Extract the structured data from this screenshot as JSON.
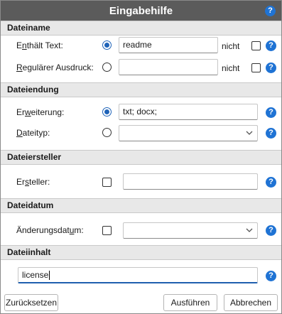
{
  "window": {
    "title": "Eingabehilfe"
  },
  "help_glyph": "?",
  "sections": {
    "dateiname": {
      "header": "Dateiname",
      "contains": {
        "label_pre": "E",
        "label_ul": "n",
        "label_post": "thält Text:",
        "value": "readme",
        "selected": true
      },
      "regex": {
        "label_pre": "",
        "label_ul": "R",
        "label_post": "egulärer Ausdruck:",
        "value": "",
        "selected": false
      },
      "not_label": "nicht"
    },
    "dateiendung": {
      "header": "Dateiendung",
      "extension": {
        "label_pre": "Er",
        "label_ul": "w",
        "label_post": "eiterung:",
        "value": "txt; docx;",
        "selected": true
      },
      "filetype": {
        "label_pre": "",
        "label_ul": "D",
        "label_post": "ateityp:",
        "value": "",
        "selected": false
      }
    },
    "dateiersteller": {
      "header": "Dateiersteller",
      "creator": {
        "label_pre": "Er",
        "label_ul": "s",
        "label_post": "teller:",
        "value": "",
        "checked": false
      }
    },
    "dateidatum": {
      "header": "Dateidatum",
      "modified": {
        "label_pre": "Änderungsdat",
        "label_ul": "u",
        "label_post": "m:",
        "value": "",
        "checked": false
      }
    },
    "dateiinhalt": {
      "header": "Dateiinhalt",
      "content": {
        "value": "license"
      }
    }
  },
  "buttons": {
    "reset": "Zurücksetzen",
    "run": "Ausführen",
    "cancel": "Abbrechen"
  },
  "colors": {
    "titlebar": "#5b5b5b",
    "accent": "#1f73d4",
    "section_bg": "#e8e8e8"
  },
  "icons": {
    "help": "help-icon",
    "dropdown": "chevron-down-icon"
  }
}
